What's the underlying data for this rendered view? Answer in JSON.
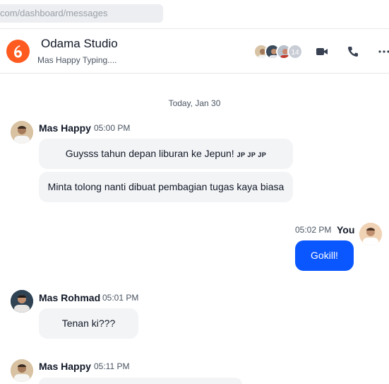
{
  "browser": {
    "url": "com/dashboard/messages"
  },
  "header": {
    "studio_name": "Odama Studio",
    "typing_status": "Mas Happy Typing....",
    "member_count": "14",
    "brand_color": "#ff5a1f"
  },
  "date_separator": "Today, Jan 30",
  "messages": [
    {
      "sender": "Mas Happy",
      "time": "05:00 PM",
      "bubbles": [
        "Guysss tahun depan liburan ke Jepun!",
        "Minta tolong nanti dibuat pembagian tugas kaya biasa"
      ],
      "emoji_text": "JP JP JP"
    },
    {
      "sender": "You",
      "time": "05:02 PM",
      "bubbles": [
        "Gokill!"
      ]
    },
    {
      "sender": "Mas Rohmad",
      "time": "05:01 PM",
      "bubbles": [
        "Tenan ki???"
      ]
    },
    {
      "sender": "Mas Happy",
      "time": "05:11 PM",
      "bubbles": []
    }
  ],
  "colors": {
    "accent": "#0b57ff",
    "bubble_bg": "#f3f4f6"
  },
  "icons": [
    "video-icon",
    "phone-icon",
    "more-icon"
  ]
}
